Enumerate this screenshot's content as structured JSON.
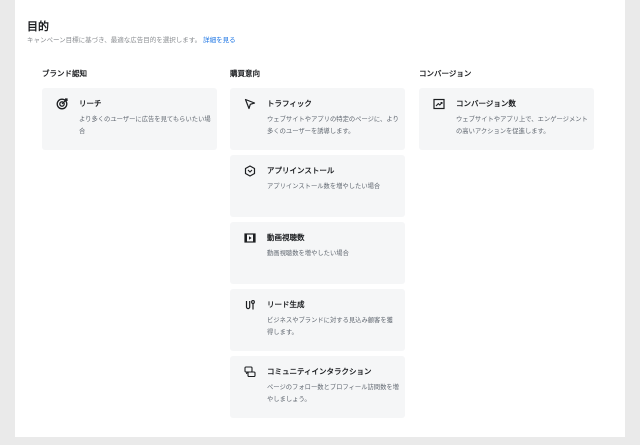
{
  "header": {
    "title": "目的",
    "subtitle": "キャンペーン目標に基づき、最適な広告目的を選択します。",
    "link": "詳細を見る"
  },
  "columns": [
    {
      "title": "ブランド認知",
      "cards": [
        {
          "icon": "target-icon",
          "title": "リーチ",
          "desc": "より多くのユーザーに広告を見てもらいたい場合"
        }
      ]
    },
    {
      "title": "購買意向",
      "cards": [
        {
          "icon": "cursor-icon",
          "title": "トラフィック",
          "desc": "ウェブサイトやアプリの特定のページに、より多くのユーザーを誘導します。"
        },
        {
          "icon": "app-cube-icon",
          "title": "アプリインストール",
          "desc": "アプリインストール数を増やしたい場合"
        },
        {
          "icon": "film-icon",
          "title": "動画視聴数",
          "desc": "動画視聴数を増やしたい場合"
        },
        {
          "icon": "magnet-icon",
          "title": "リード生成",
          "desc": "ビジネスやブランドに対する見込み顧客を獲得します。"
        },
        {
          "icon": "chat-bubbles-icon",
          "title": "コミュニティインタラクション",
          "desc": "ページのフォロー数とプロフィール訪問数を増やしましょう。"
        }
      ]
    },
    {
      "title": "コンバージョン",
      "cards": [
        {
          "icon": "trend-chart-icon",
          "title": "コンバージョン数",
          "desc": "ウェブサイトやアプリ上で、エンゲージメントの高いアクションを促進します。"
        }
      ]
    }
  ]
}
